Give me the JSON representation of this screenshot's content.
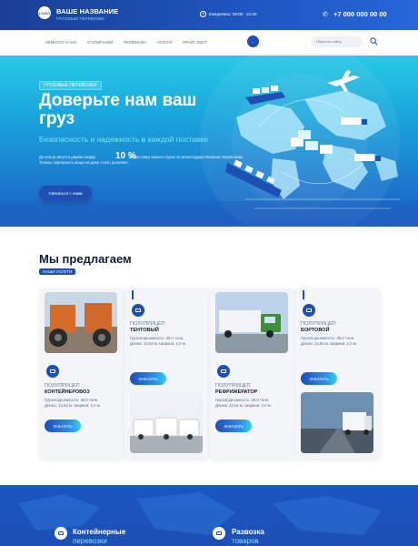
{
  "header": {
    "logo_text": "LOGO",
    "brand_title": "ВАШЕ НАЗВАНИЕ",
    "brand_sub": "ГРУЗОВЫЕ ПЕРЕВОЗКИ",
    "hours": "Ежедневно: 09:00 - 21:00",
    "phone": "+7 000 000 00 00",
    "bg_color": "#1f56c2"
  },
  "nav": {
    "items": [
      "НЕМНОГО О НАС",
      "О КОМПАНИИ",
      "ПЕРЕВОЗКА",
      "УСЛУГИ",
      "ПРАЙС-ЛИСТ"
    ],
    "button_label": "...",
    "search_placeholder": "Поиск по сайту"
  },
  "hero": {
    "badge": "Грузовые перевозки",
    "title": "Доверьте нам ваш груз",
    "subtitle": "Безопасность и надежность в каждой поставке",
    "text_before": "До конца августа дарим скидку",
    "percent": "10 %",
    "text_after": "на доставку вашего груза по межгосударственным перевозкам. Теперь перевозить вещи на дачу стало дешевле.",
    "button": "Связаться с нами"
  },
  "offers": {
    "title": "Мы предлагаем",
    "badge": "Наши услуги",
    "cards": [
      {
        "category": "Полуприцеп",
        "name": "Тентовый",
        "specs": "Грузоподъемность: 39,0 тонн. Длина: 13,62 м. Ширина: 2,0 м.",
        "button": "ЗАКАЗАТЬ"
      },
      {
        "category": "Полуприцеп",
        "name": "Контейнеровоз",
        "specs": "Грузоподъемность: 40,0 тонн. Длина: 13,62 м. Ширина: 2,0 м.",
        "button": "ЗАКАЗАТЬ"
      },
      {
        "category": "Полуприцеп",
        "name": "Рефрижератор",
        "specs": "Грузоподъемность: 28,0 тонн. Длина: 13,62 м. Ширина: 2,0 м.",
        "button": "ЗАКАЗАТЬ"
      },
      {
        "category": "Полуприцеп",
        "name": "Бортовой",
        "specs": "Грузоподъемность: 39,0 тонн. Длина: 13,62 м. Ширина: 2,0 м.",
        "button": "ЗАКАЗАТЬ"
      }
    ]
  },
  "bottom": {
    "items": [
      {
        "title": "Контейнерные",
        "sub": "перевозки"
      },
      {
        "title": "Развозка",
        "sub": "товаров"
      }
    ]
  },
  "colors": {
    "accent": "#1d4fb5",
    "cyan": "#34d3e6"
  },
  "icons": [
    "clock-icon",
    "phone-icon",
    "search-icon",
    "truck-icon",
    "container-icon"
  ]
}
